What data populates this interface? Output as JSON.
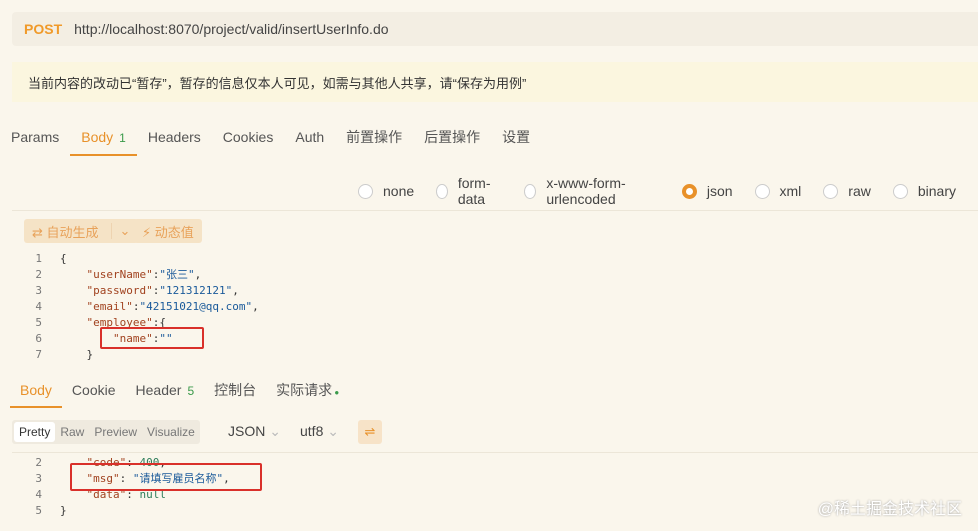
{
  "request": {
    "method": "POST",
    "url": "http://localhost:8070/project/valid/insertUserInfo.do"
  },
  "notice": "当前内容的改动已“暂存”，暂存的信息仅本人可见，如需与其他人共享，请“保存为用例”",
  "tabs": [
    {
      "label": "Params"
    },
    {
      "label": "Body",
      "badge": "1"
    },
    {
      "label": "Headers"
    },
    {
      "label": "Cookies"
    },
    {
      "label": "Auth"
    },
    {
      "label": "前置操作"
    },
    {
      "label": "后置操作"
    },
    {
      "label": "设置"
    }
  ],
  "body_types": [
    "none",
    "form-data",
    "x-www-form-urlencoded",
    "json",
    "xml",
    "raw",
    "binary"
  ],
  "selected_body_type": "json",
  "editor_tools": {
    "auto": "⇄ 自动生成",
    "dynamic": "⚡ 动态值",
    "dropdown": "⌄"
  },
  "request_body": [
    {
      "n": "1",
      "parts": [
        [
          "p",
          "{"
        ]
      ]
    },
    {
      "n": "2",
      "parts": [
        [
          "k",
          "    \"userName\""
        ],
        [
          "p",
          ":"
        ],
        [
          "s",
          "\"张三\""
        ],
        [
          "p",
          ","
        ]
      ]
    },
    {
      "n": "3",
      "parts": [
        [
          "k",
          "    \"password\""
        ],
        [
          "p",
          ":"
        ],
        [
          "s",
          "\"121312121\""
        ],
        [
          "p",
          ","
        ]
      ]
    },
    {
      "n": "4",
      "parts": [
        [
          "k",
          "    \"email\""
        ],
        [
          "p",
          ":"
        ],
        [
          "s",
          "\"42151021@qq.com\""
        ],
        [
          "p",
          ","
        ]
      ]
    },
    {
      "n": "5",
      "parts": [
        [
          "k",
          "    \"employee\""
        ],
        [
          "p",
          ":{"
        ]
      ]
    },
    {
      "n": "6",
      "parts": [
        [
          "k",
          "        \"name\""
        ],
        [
          "p",
          ":"
        ],
        [
          "s",
          "\"\""
        ]
      ]
    },
    {
      "n": "7",
      "parts": [
        [
          "p",
          "    }"
        ]
      ]
    }
  ],
  "response_tabs": [
    {
      "label": "Body"
    },
    {
      "label": "Cookie"
    },
    {
      "label": "Header",
      "badge": "5"
    },
    {
      "label": "控制台"
    },
    {
      "label": "实际请求"
    }
  ],
  "view_modes": [
    "Pretty",
    "Raw",
    "Preview",
    "Visualize"
  ],
  "format": "JSON",
  "encoding": "utf8",
  "response_body": [
    {
      "n": "2",
      "parts": [
        [
          "k",
          "    \"code\""
        ],
        [
          "p",
          ": "
        ],
        [
          "n",
          "400"
        ],
        [
          "p",
          ","
        ]
      ]
    },
    {
      "n": "3",
      "parts": [
        [
          "k",
          "    \"msg\""
        ],
        [
          "p",
          ": "
        ],
        [
          "s",
          "\"请填写雇员名称\""
        ],
        [
          "p",
          ","
        ]
      ]
    },
    {
      "n": "4",
      "parts": [
        [
          "k",
          "    \"data\""
        ],
        [
          "p",
          ": "
        ],
        [
          "n",
          "null"
        ]
      ]
    },
    {
      "n": "5",
      "parts": [
        [
          "p",
          "}"
        ]
      ]
    }
  ],
  "watermark": "@稀土掘金技术社区"
}
